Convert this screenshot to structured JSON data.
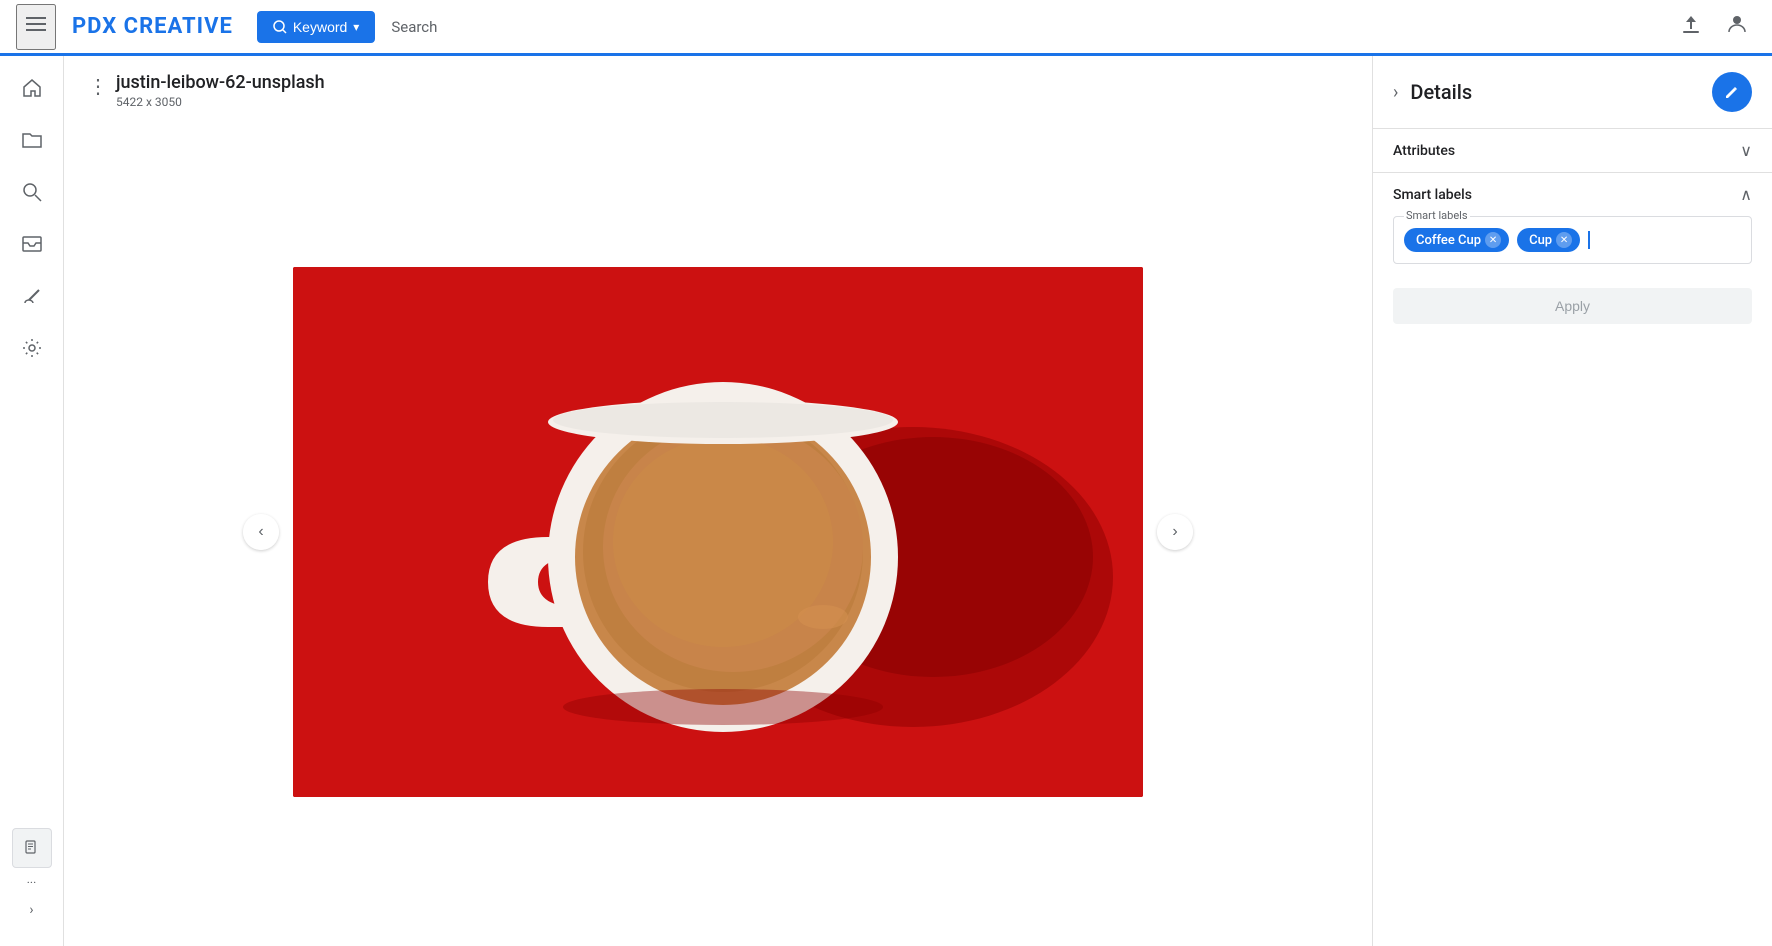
{
  "topbar": {
    "menu_icon": "☰",
    "logo": "PDX CREATIVE",
    "keyword_btn_label": "Keyword",
    "search_label": "Search",
    "upload_icon": "⬆",
    "account_icon": "👤"
  },
  "sidebar": {
    "icons": [
      {
        "name": "home-icon",
        "symbol": "⌂"
      },
      {
        "name": "folder-icon",
        "symbol": "▭"
      },
      {
        "name": "search-icon",
        "symbol": "🔍"
      },
      {
        "name": "inbox-icon",
        "symbol": "📥"
      },
      {
        "name": "brush-icon",
        "symbol": "🖊"
      },
      {
        "name": "settings-icon",
        "symbol": "⚙"
      }
    ],
    "bottom": {
      "doc_icon": "📄",
      "more_label": "...",
      "expand_icon": "›"
    }
  },
  "file_info": {
    "title": "justin-leibow-62-unsplash",
    "dimensions": "5422 x 3050",
    "menu_icon": "⋮"
  },
  "navigation": {
    "prev_label": "‹",
    "next_label": "›"
  },
  "right_panel": {
    "collapse_icon": "›",
    "title": "Details",
    "edit_icon": "✏",
    "attributes_label": "Attributes",
    "attributes_chevron": "∨",
    "smart_labels_title": "Smart labels",
    "smart_labels_chevron": "∧",
    "smart_labels_legend": "Smart labels",
    "tags": [
      {
        "id": "tag-coffee-cup",
        "label": "Coffee Cup"
      },
      {
        "id": "tag-cup",
        "label": "Cup"
      }
    ],
    "apply_label": "Apply"
  },
  "colors": {
    "brand_blue": "#1a73e8",
    "coffee_bg": "#cc0000",
    "cup_white": "#f5f0eb",
    "coffee_brown": "#b5651d",
    "shadow": "#8b0000"
  }
}
